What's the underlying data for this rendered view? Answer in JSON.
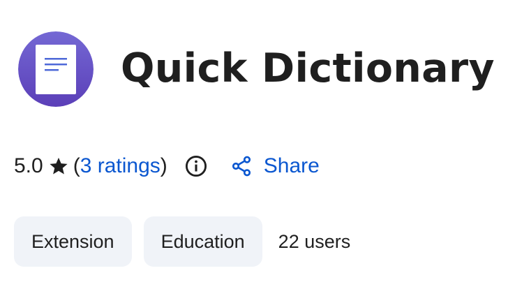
{
  "app": {
    "name": "Quick Dictionary",
    "icon": "document-icon",
    "icon_color": "#6650c8"
  },
  "rating": {
    "value": "5.0",
    "star_icon": "star-icon",
    "open_paren": "(",
    "ratings_text": "3 ratings",
    "close_paren": ")",
    "info_icon": "info-icon"
  },
  "share": {
    "label": "Share",
    "icon": "share-icon"
  },
  "chips": {
    "type_label": "Extension",
    "category_label": "Education"
  },
  "users_text": "22 users",
  "colors": {
    "accent": "#0b57d0",
    "text": "#1f1f1f",
    "chip_bg": "#f0f3f8"
  }
}
